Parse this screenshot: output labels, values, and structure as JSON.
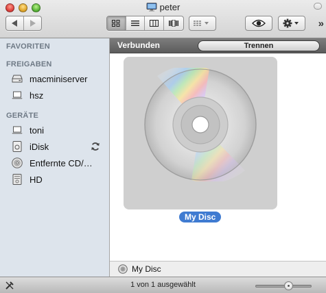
{
  "window": {
    "title": "peter"
  },
  "toolbar": {
    "back_icon": "back-arrow-icon",
    "forward_icon": "forward-arrow-icon",
    "views": [
      "icon-view",
      "list-view",
      "column-view",
      "cover-flow-view"
    ],
    "active_view": "icon-view",
    "arrange_icon": "arrange-grid-icon",
    "quicklook_icon": "eye-icon",
    "action_icon": "gear-icon",
    "overflow": "»"
  },
  "sidebar": {
    "sections": [
      {
        "title": "FAVORITEN",
        "items": []
      },
      {
        "title": "FREIGABEN",
        "items": [
          {
            "label": "macminiserver",
            "icon": "server-icon"
          },
          {
            "label": "hsz",
            "icon": "laptop-icon"
          }
        ]
      },
      {
        "title": "GERÄTE",
        "items": [
          {
            "label": "toni",
            "icon": "laptop-icon"
          },
          {
            "label": "iDisk",
            "icon": "idisk-icon",
            "badge_icon": "sync-icon"
          },
          {
            "label": "Entfernte CD/…",
            "icon": "cd-icon"
          },
          {
            "label": "HD",
            "icon": "harddisk-icon"
          }
        ]
      }
    ]
  },
  "pathbar": {
    "status": "Verbunden",
    "button": "Trennen"
  },
  "content": {
    "item_name": "My Disc",
    "item_icon": "cd-disc-icon"
  },
  "path": {
    "label": "My Disc",
    "icon": "cd-small-icon"
  },
  "status": {
    "text": "1 von 1 ausgewählt",
    "zoom": 0.55
  },
  "colors": {
    "selection": "#3f7bd1",
    "sidebar": "#dde4ec",
    "pathbar": "#6a6a6a"
  }
}
